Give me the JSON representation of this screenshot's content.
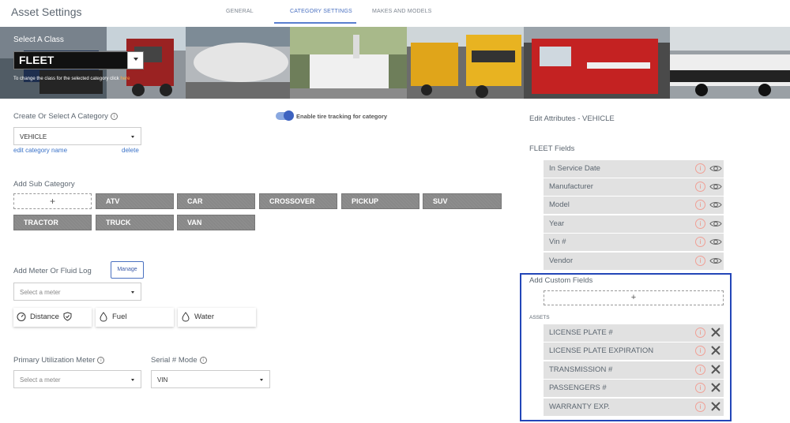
{
  "header": {
    "title": "Asset Settings",
    "tabs": [
      {
        "label": "GENERAL",
        "active": false
      },
      {
        "label": "CATEGORY SETTINGS",
        "active": true
      },
      {
        "label": "MAKES AND MODELS",
        "active": false
      }
    ]
  },
  "banner": {
    "select_class_label": "Select A Class",
    "class_value": "FLEET",
    "help_prefix": "To change the class for the selected category click ",
    "help_link": "here"
  },
  "category": {
    "label": "Create Or Select A Category",
    "value": "VEHICLE",
    "edit_link": "edit category name",
    "delete_link": "delete",
    "tire_tracking_label": "Enable tire tracking for category",
    "tire_tracking_enabled": true
  },
  "sub_category": {
    "label": "Add Sub Category",
    "add_symbol": "+",
    "chips": [
      "ATV",
      "CAR",
      "CROSSOVER",
      "PICKUP",
      "SUV",
      "TRACTOR",
      "TRUCK",
      "VAN"
    ]
  },
  "meter": {
    "label": "Add Meter Or Fluid Log",
    "manage_label": "Manage",
    "select_placeholder": "Select a meter",
    "cards": [
      {
        "label": "Distance",
        "icon": "speedometer-shield-icon"
      },
      {
        "label": "Fuel",
        "icon": "droplet-icon"
      },
      {
        "label": "Water",
        "icon": "droplet-icon"
      }
    ]
  },
  "utilization": {
    "primary_label": "Primary Utilization Meter",
    "primary_placeholder": "Select a meter",
    "serial_label": "Serial # Mode",
    "serial_value": "VIN"
  },
  "attributes": {
    "title": "Edit Attributes - VEHICLE",
    "fleet_fields_label": "FLEET Fields",
    "fleet_fields": [
      "In Service Date",
      "Manufacturer",
      "Model",
      "Year",
      "Vin #",
      "Vendor"
    ],
    "add_custom_label": "Add Custom Fields",
    "add_symbol": "+",
    "assets_label": "ASSETS",
    "custom_fields": [
      "LICENSE PLATE #",
      "LICENSE PLATE EXPIRATION",
      "TRANSMISSION #",
      "PASSENGERS #",
      "WARRANTY EXP."
    ],
    "info_symbol": "i"
  },
  "colors": {
    "accent": "#4a70c0",
    "highlight_border": "#2346b8",
    "chip_bg": "#888888",
    "info_icon": "#f08a7c",
    "help_link": "#ffa842"
  }
}
